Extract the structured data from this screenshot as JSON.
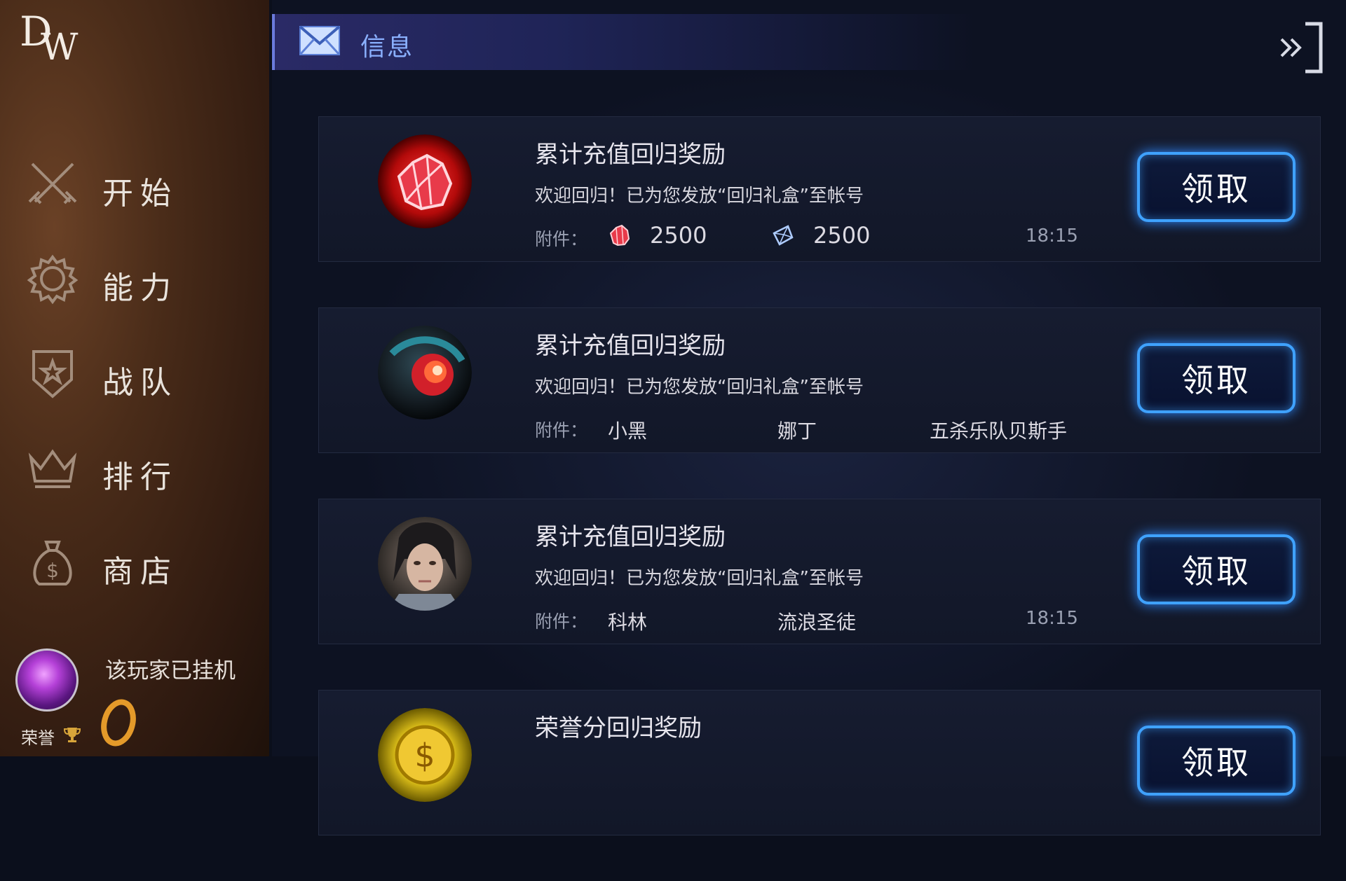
{
  "sidebar": {
    "logo": {
      "d": "D",
      "w": "W"
    },
    "nav": [
      {
        "label": "开始",
        "icon": "crossed-swords-icon"
      },
      {
        "label": "能力",
        "icon": "gear-icon"
      },
      {
        "label": "战队",
        "icon": "shield-star-icon"
      },
      {
        "label": "排行",
        "icon": "crown-icon"
      },
      {
        "label": "商店",
        "icon": "money-bag-icon"
      }
    ],
    "player": {
      "status": "该玩家已挂机",
      "honor_label": "荣誉"
    }
  },
  "header": {
    "title": "信息",
    "icon": "mail-icon",
    "collapse_icon": "collapse-right-icon"
  },
  "colors": {
    "accent_blue": "#3fa2ff",
    "header_title": "#8ab0ff",
    "sidebar_bg": "#4a2c19"
  },
  "mails": [
    {
      "title": "累计充值回归奖励",
      "description": "欢迎回归！已为您发放“回归礼盒”至帐号",
      "attachment_label": "附件：",
      "attachments": [
        {
          "icon": "red-crystal-icon",
          "text": "2500"
        },
        {
          "icon": "diamond-icon",
          "text": "2500"
        }
      ],
      "time": "18:15",
      "button": "领取",
      "thumb_icon": "red-crystal-icon"
    },
    {
      "title": "累计充值回归奖励",
      "description": "欢迎回归！已为您发放“回归礼盒”至帐号",
      "attachment_label": "附件：",
      "attachments": [
        {
          "text": "小黑"
        },
        {
          "text": "娜丁"
        },
        {
          "text": "五杀乐队贝斯手"
        }
      ],
      "time": "",
      "button": "领取",
      "thumb_icon": "mech-eye-icon"
    },
    {
      "title": "累计充值回归奖励",
      "description": "欢迎回归！已为您发放“回归礼盒”至帐号",
      "attachment_label": "附件：",
      "attachments": [
        {
          "text": "科林"
        },
        {
          "text": "流浪圣徒"
        }
      ],
      "time": "18:15",
      "button": "领取",
      "thumb_icon": "hero-portrait-icon"
    },
    {
      "title": "荣誉分回归奖励",
      "button": "领取",
      "thumb_icon": "gold-coin-icon"
    }
  ]
}
